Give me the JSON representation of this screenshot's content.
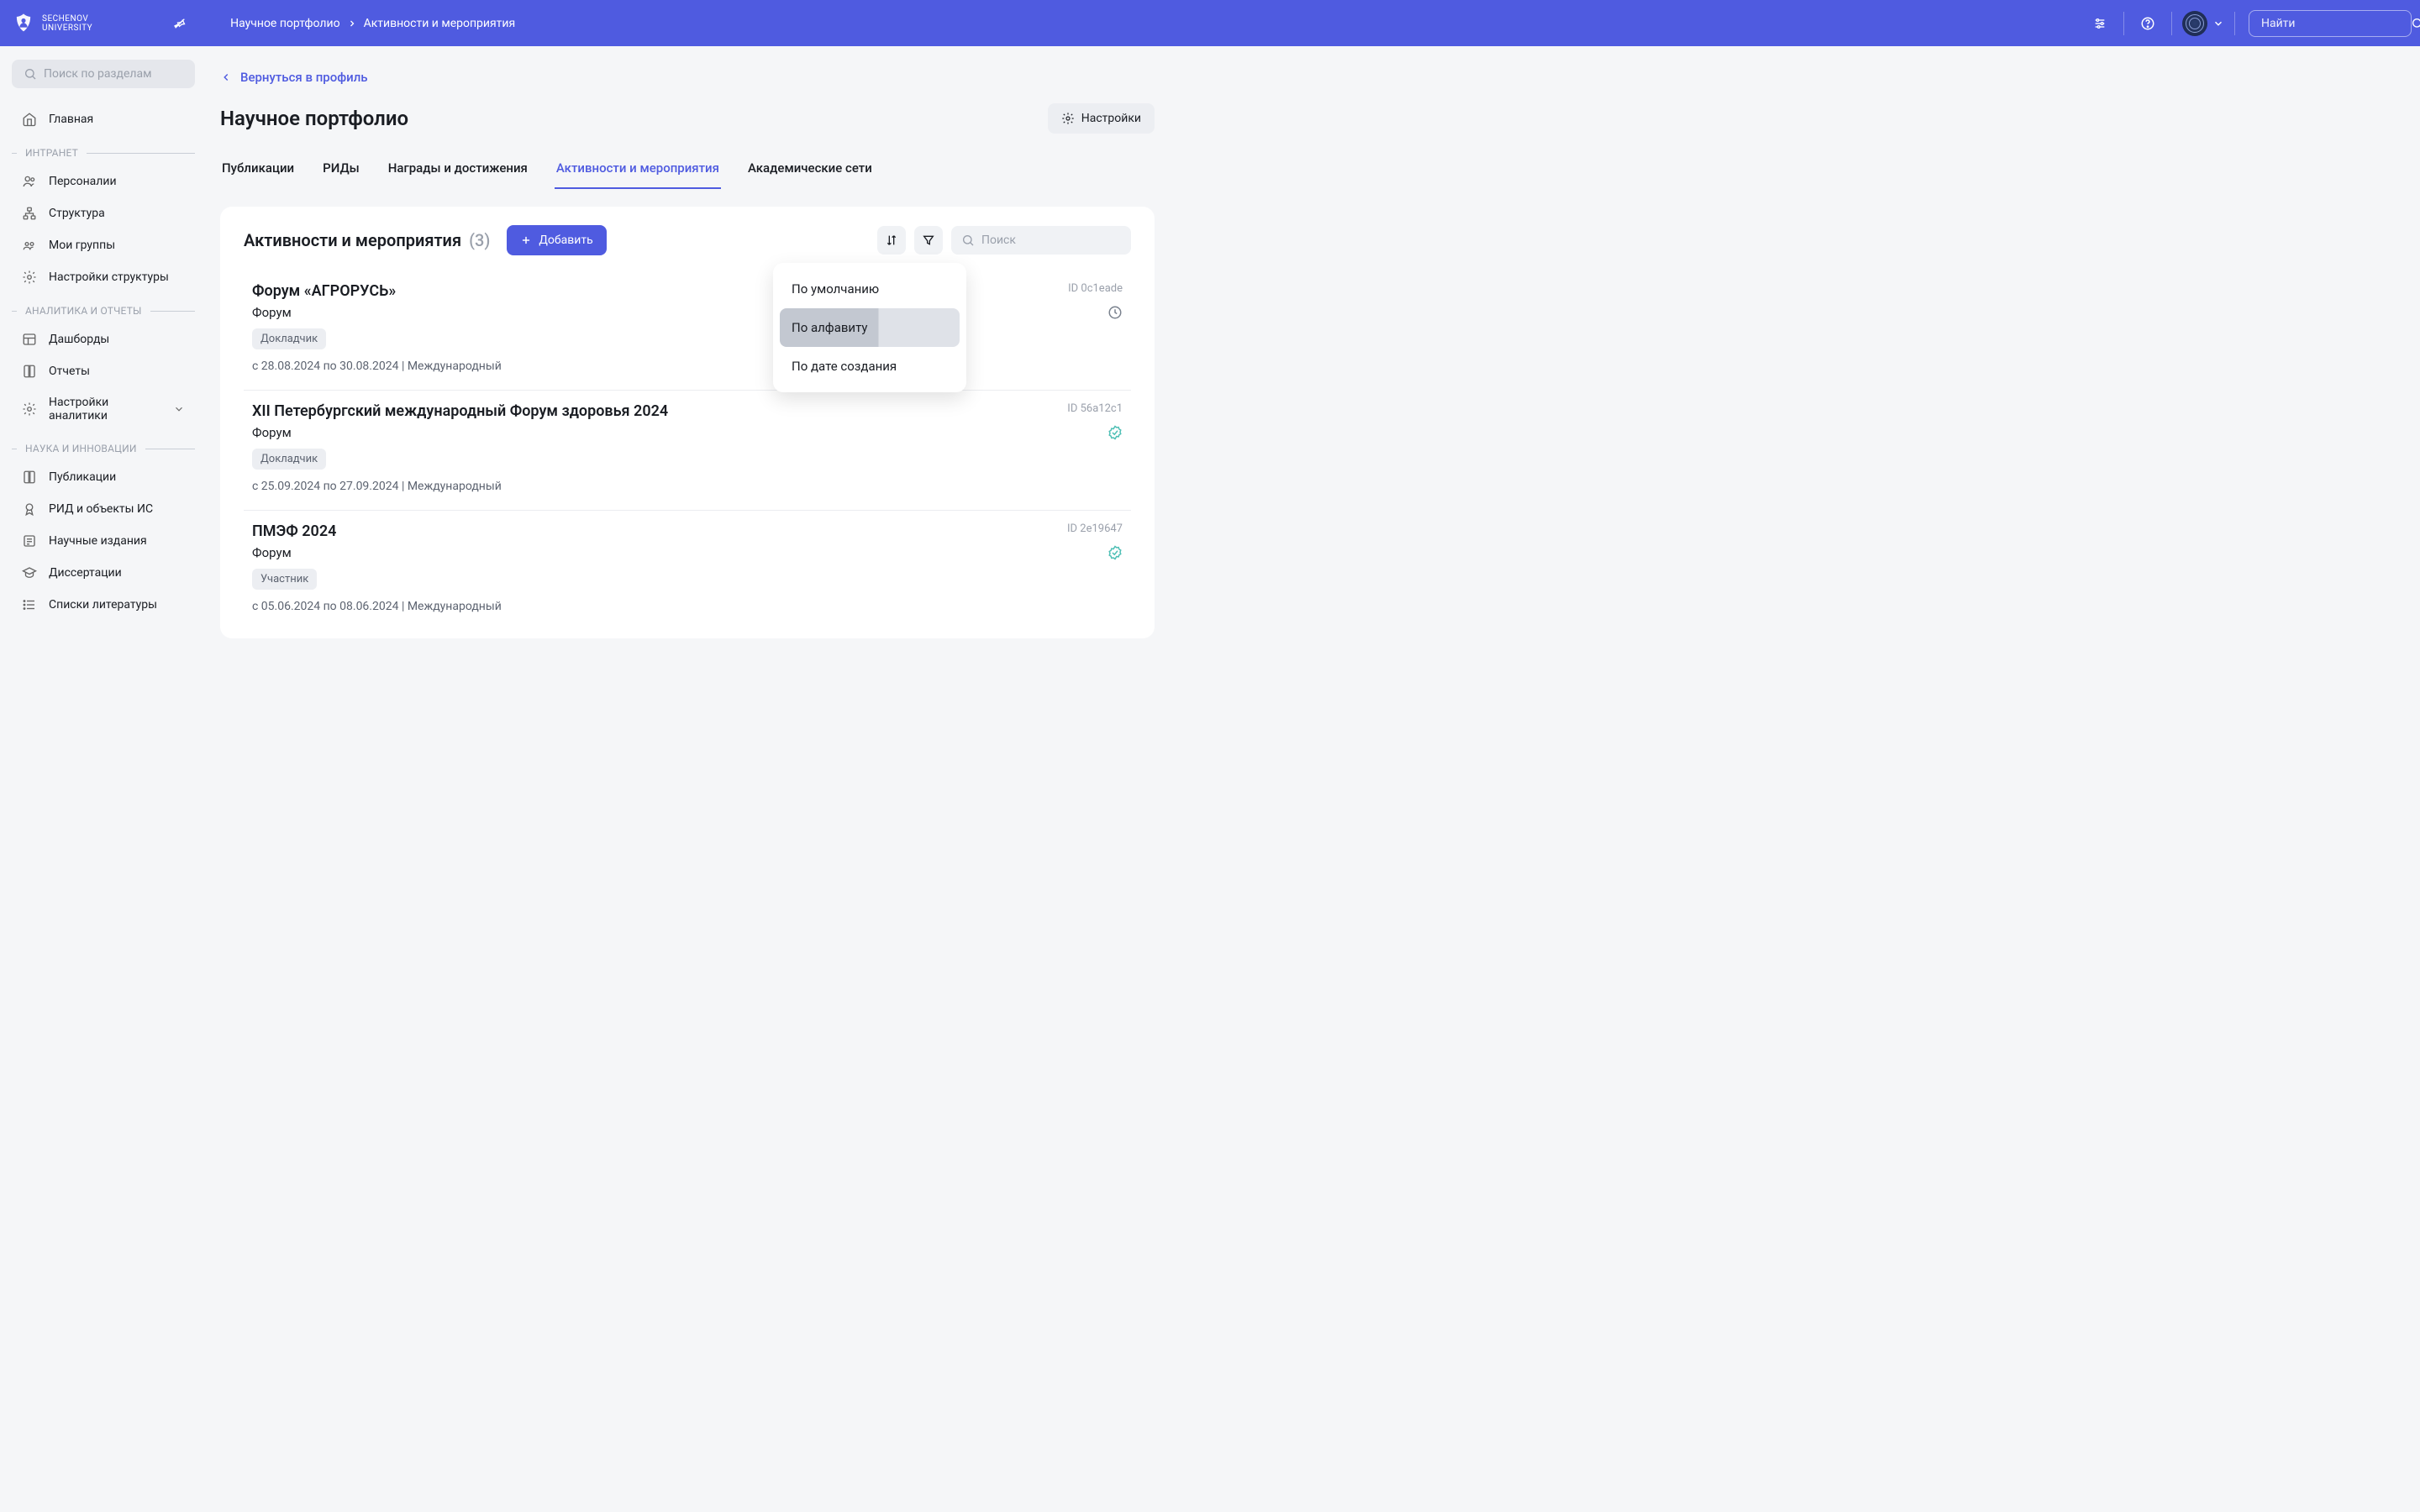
{
  "header": {
    "logo_line1": "SECHENOV",
    "logo_line2": "UNIVERSITY",
    "breadcrumb": [
      "Научное портфолио",
      "Активности и мероприятия"
    ],
    "search_placeholder": "Найти"
  },
  "sidebar": {
    "search_placeholder": "Поиск по разделам",
    "home": "Главная",
    "sections": [
      {
        "label": "ИНТРАНЕТ",
        "items": [
          "Персоналии",
          "Структура",
          "Мои группы",
          "Настройки структуры"
        ]
      },
      {
        "label": "АНАЛИТИКА И ОТЧЕТЫ",
        "items": [
          "Дашборды",
          "Отчеты",
          "Настройки аналитики"
        ]
      },
      {
        "label": "НАУКА И ИННОВАЦИИ",
        "items": [
          "Публикации",
          "РИД и объекты ИС",
          "Научные издания",
          "Диссертации",
          "Списки литературы"
        ]
      }
    ]
  },
  "main": {
    "back": "Вернуться в профиль",
    "title": "Научное портфолио",
    "settings": "Настройки",
    "tabs": [
      "Публикации",
      "РИДы",
      "Награды и достижения",
      "Активности и мероприятия",
      "Академические сети"
    ],
    "active_tab_index": 3,
    "card_title": "Активности и мероприятия",
    "card_count": "(3)",
    "add": "Добавить",
    "search_placeholder": "Поиск",
    "sort_menu": [
      "По умолчанию",
      "По алфавиту",
      "По дате создания"
    ],
    "events": [
      {
        "title": "Форум «АГРОРУСЬ»",
        "id": "ID 0c1eade",
        "type": "Форум",
        "status": "pending",
        "role": "Докладчик",
        "dates": "с 28.08.2024 по 30.08.2024",
        "scope": "Международный"
      },
      {
        "title": "XII Петербургский международный Форум здоровья 2024",
        "id": "ID 56a12c1",
        "type": "Форум",
        "status": "verified",
        "role": "Докладчик",
        "dates": "с 25.09.2024 по 27.09.2024",
        "scope": "Международный"
      },
      {
        "title": "ПМЭФ 2024",
        "id": "ID 2e19647",
        "type": "Форум",
        "status": "verified",
        "role": "Участник",
        "dates": "с 05.06.2024 по 08.06.2024",
        "scope": "Международный"
      }
    ]
  }
}
